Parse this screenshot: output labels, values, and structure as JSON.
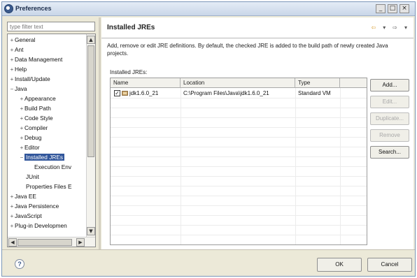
{
  "window": {
    "title": "Preferences",
    "minimize": "_",
    "maximize": "□",
    "close": "×"
  },
  "filter": {
    "placeholder": "type filter text"
  },
  "tree": {
    "items": [
      {
        "label": "General",
        "expander": "+"
      },
      {
        "label": "Ant",
        "expander": "+"
      },
      {
        "label": "Data Management",
        "expander": "+"
      },
      {
        "label": "Help",
        "expander": "+"
      },
      {
        "label": "Install/Update",
        "expander": "+"
      },
      {
        "label": "Java",
        "expander": "−"
      },
      {
        "label": "Appearance",
        "expander": "+"
      },
      {
        "label": "Build Path",
        "expander": "+"
      },
      {
        "label": "Code Style",
        "expander": "+"
      },
      {
        "label": "Compiler",
        "expander": "+"
      },
      {
        "label": "Debug",
        "expander": "+"
      },
      {
        "label": "Editor",
        "expander": "+"
      },
      {
        "label": "Installed JREs",
        "expander": "−",
        "selected": true
      },
      {
        "label": "Execution Env",
        "expander": ""
      },
      {
        "label": "JUnit",
        "expander": ""
      },
      {
        "label": "Properties Files E",
        "expander": ""
      },
      {
        "label": "Java EE",
        "expander": "+"
      },
      {
        "label": "Java Persistence",
        "expander": "+"
      },
      {
        "label": "JavaScript",
        "expander": "+"
      },
      {
        "label": "Plug-in Developmen",
        "expander": "+"
      }
    ]
  },
  "page": {
    "title": "Installed JREs",
    "description": "Add, remove or edit JRE definitions. By default, the checked JRE is added to the build path of newly created Java projects.",
    "list_label": "Installed JREs:"
  },
  "table": {
    "columns": [
      "Name",
      "Location",
      "Type"
    ],
    "rows": [
      {
        "checked": true,
        "check_glyph": "✓",
        "name": "jdk1.6.0_21",
        "location": "C:\\Program Files\\Java\\jdk1.6.0_21",
        "type": "Standard VM"
      }
    ]
  },
  "buttons": {
    "add": "Add...",
    "edit": "Edit...",
    "duplicate": "Duplicate...",
    "remove": "Remove",
    "search": "Search..."
  },
  "dialog": {
    "help": "?",
    "ok": "OK",
    "cancel": "Cancel"
  },
  "colors": {
    "selection": "#31569b",
    "accent": "#d79a2b"
  }
}
